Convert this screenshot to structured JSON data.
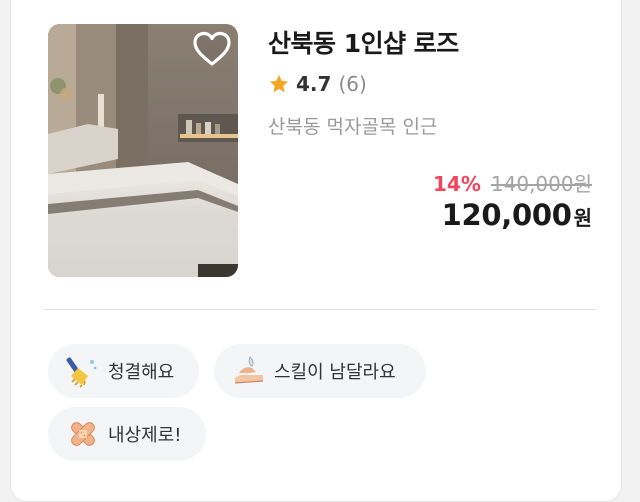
{
  "product": {
    "title": "산북동 1인샵 로즈",
    "rating": "4.7",
    "review_count": "(6)",
    "location": "산북동 먹자골목 인근",
    "discount_rate": "14%",
    "original_price": "140,000원",
    "price": "120,000",
    "currency": "원",
    "favorited": false,
    "image_icon": "spa-room-photo"
  },
  "tags": [
    {
      "label": "청결해요",
      "icon": "broom-icon"
    },
    {
      "label": "스킬이 남달라요",
      "icon": "massage-hands-icon"
    },
    {
      "label": "내상제로!",
      "icon": "bandage-icon"
    }
  ],
  "colors": {
    "discount": "#f0455b",
    "star": "#f5a623",
    "tag_bg": "#f4f5f7",
    "muted_text": "#9a9a9a"
  }
}
